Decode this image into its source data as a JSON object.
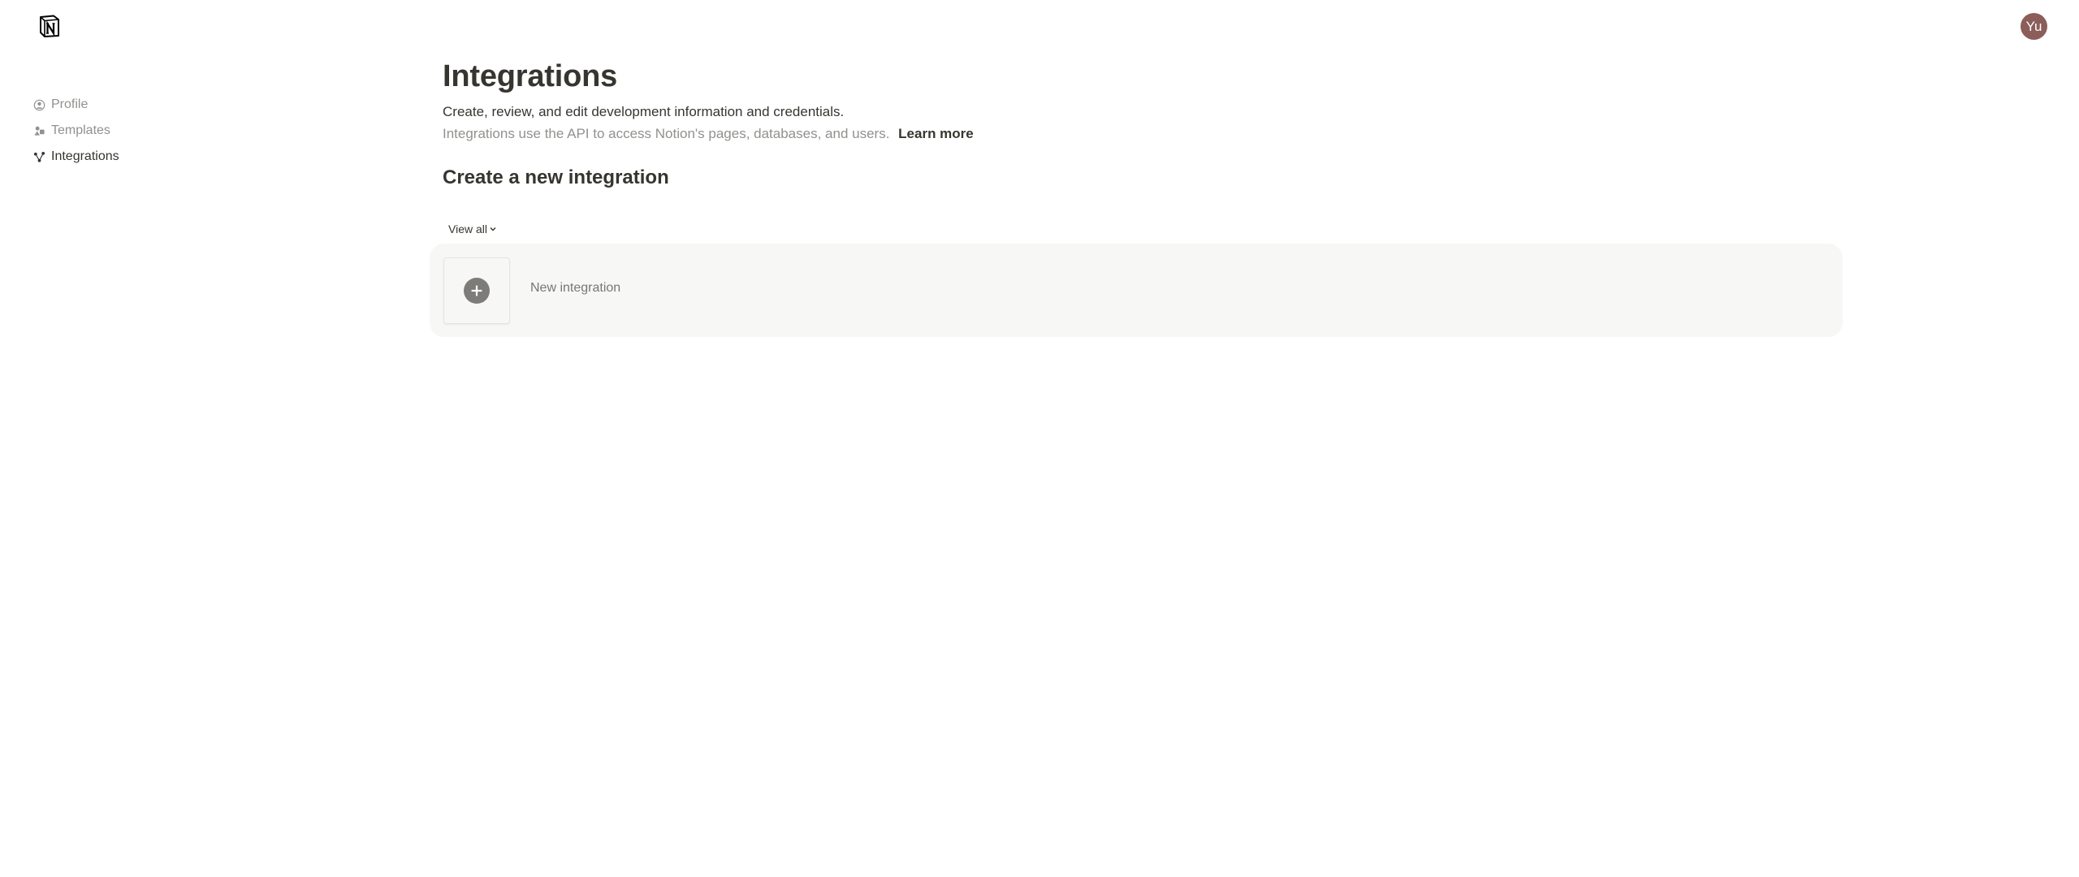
{
  "app": {
    "logo_icon": "notion-logo-icon",
    "avatar_initials": "Yu",
    "avatar_color": "#8b5e5a"
  },
  "sidebar": {
    "items": [
      {
        "label": "Profile",
        "icon": "profile-icon",
        "active": false
      },
      {
        "label": "Templates",
        "icon": "templates-icon",
        "active": false
      },
      {
        "label": "Integrations",
        "icon": "integrations-icon",
        "active": true
      }
    ]
  },
  "main": {
    "title": "Integrations",
    "subtitle": "Create, review, and edit development information and credentials.",
    "description": "Integrations use the API to access Notion's pages, databases, and users.",
    "learn_more": "Learn more",
    "section_title": "Create a new integration",
    "view_all_label": "View all",
    "new_integration_label": "New integration"
  },
  "colors": {
    "text_primary": "#37352f",
    "text_secondary": "#91918e",
    "card_background": "#f7f7f5"
  }
}
